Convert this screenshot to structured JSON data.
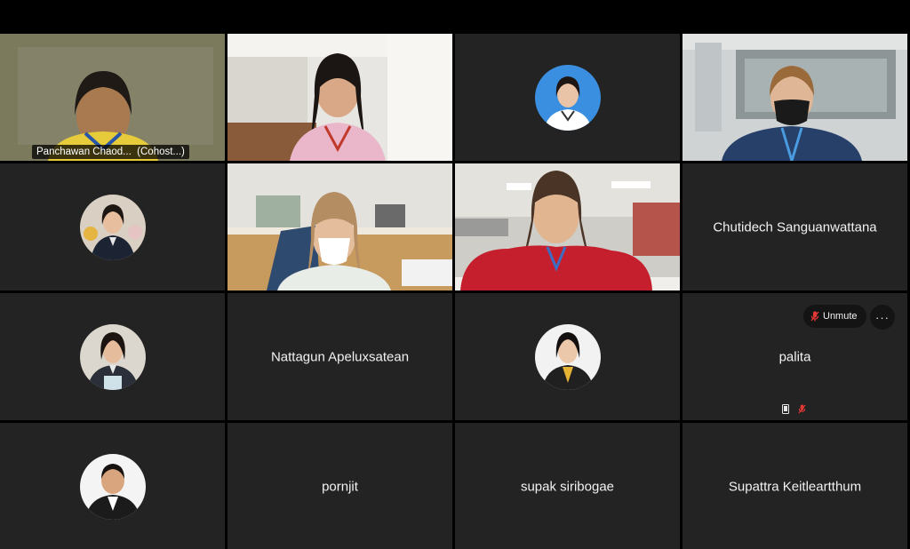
{
  "participants": [
    {
      "name": "Panchawan Chaod...  (Cohost...)",
      "kind": "video"
    },
    {
      "name": "",
      "kind": "video"
    },
    {
      "name": "",
      "kind": "avatar"
    },
    {
      "name": "",
      "kind": "video"
    },
    {
      "name": "",
      "kind": "avatar"
    },
    {
      "name": "",
      "kind": "video"
    },
    {
      "name": "",
      "kind": "video"
    },
    {
      "name": "Chutidech Sanguanwattana",
      "kind": "name"
    },
    {
      "name": "",
      "kind": "avatar"
    },
    {
      "name": "Nattagun Apeluxsatean",
      "kind": "name"
    },
    {
      "name": "",
      "kind": "avatar"
    },
    {
      "name": "palita",
      "kind": "name"
    },
    {
      "name": "",
      "kind": "avatar"
    },
    {
      "name": "pornjit",
      "kind": "name"
    },
    {
      "name": "supak siribogae",
      "kind": "name"
    },
    {
      "name": "Supattra Keitleartthum",
      "kind": "name"
    }
  ],
  "controls": {
    "unmute_label": "Unmute",
    "more_label": "···"
  },
  "icons": {
    "mic_muted": "mic-muted-icon",
    "more": "more-options-icon",
    "phone": "phone-icon"
  },
  "colors": {
    "active_speaker_border": "#2aa7e6",
    "tile_background": "#232323",
    "muted_red": "#e53935"
  }
}
